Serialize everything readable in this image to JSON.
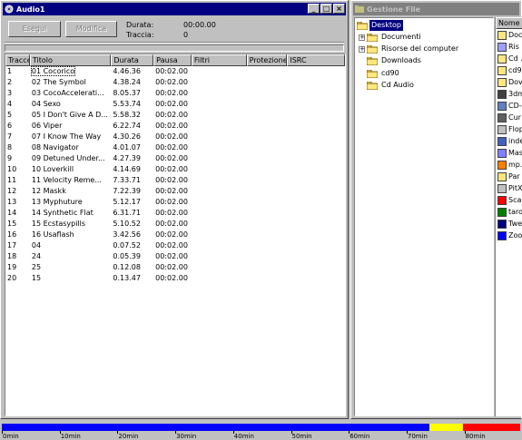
{
  "audio_window": {
    "title": "Audio1",
    "buttons": {
      "run": "Esegui",
      "edit": "Modifica"
    },
    "info": {
      "duration_label": "Durata:",
      "duration_value": "00:00.00",
      "tracks_label": "Traccia:",
      "tracks_value": "0"
    },
    "columns": [
      "Tracce",
      "Titolo",
      "Durata",
      "Pausa",
      "Filtri",
      "Protezione",
      "ISRC"
    ],
    "rows": [
      {
        "n": "1",
        "title": "01 Cocorico",
        "dur": "4.46.36",
        "pause": "00:02.00"
      },
      {
        "n": "2",
        "title": "02 The Symbol",
        "dur": "4.38.24",
        "pause": "00:02.00"
      },
      {
        "n": "3",
        "title": "03 CocoAccelerati...",
        "dur": "8.05.37",
        "pause": "00:02.00"
      },
      {
        "n": "4",
        "title": "04 Sexo",
        "dur": "5.53.74",
        "pause": "00:02.00"
      },
      {
        "n": "5",
        "title": "05 I Don't Give A D...",
        "dur": "5.58.32",
        "pause": "00:02.00"
      },
      {
        "n": "6",
        "title": "06 Viper",
        "dur": "6.22.74",
        "pause": "00:02.00"
      },
      {
        "n": "7",
        "title": "07 I Know The Way",
        "dur": "4.30.26",
        "pause": "00:02.00"
      },
      {
        "n": "8",
        "title": "08 Navigator",
        "dur": "4.01.07",
        "pause": "00:02.00"
      },
      {
        "n": "9",
        "title": "09 Detuned Under...",
        "dur": "4.27.39",
        "pause": "00:02.00"
      },
      {
        "n": "10",
        "title": "10 Loverkill",
        "dur": "4.14.69",
        "pause": "00:02.00"
      },
      {
        "n": "11",
        "title": "11 Velocity Reme...",
        "dur": "7.33.71",
        "pause": "00:02.00"
      },
      {
        "n": "12",
        "title": "12 Maskk",
        "dur": "7.22.39",
        "pause": "00:02.00"
      },
      {
        "n": "13",
        "title": "13 Myphuture",
        "dur": "5.12.17",
        "pause": "00:02.00"
      },
      {
        "n": "14",
        "title": "14 Synthetic Flat",
        "dur": "6.31.71",
        "pause": "00:02.00"
      },
      {
        "n": "15",
        "title": "15 Ecstasypills",
        "dur": "5.10.52",
        "pause": "00:02.00"
      },
      {
        "n": "16",
        "title": "16 Usaflash",
        "dur": "3.42.56",
        "pause": "00:02.00"
      },
      {
        "n": "17",
        "title": "04",
        "dur": "0.07.52",
        "pause": "00:02.00"
      },
      {
        "n": "18",
        "title": "24",
        "dur": "0.05.39",
        "pause": "00:02.00"
      },
      {
        "n": "19",
        "title": "25",
        "dur": "0.12.08",
        "pause": "00:02.00"
      },
      {
        "n": "20",
        "title": "15",
        "dur": "0.13.47",
        "pause": "00:02.00"
      }
    ]
  },
  "file_window": {
    "title": "Gestione File",
    "tree": [
      {
        "label": "Desktop",
        "level": 0,
        "expander": false,
        "selected": true
      },
      {
        "label": "Documenti",
        "level": 1,
        "expander": true,
        "selected": false
      },
      {
        "label": "Risorse del computer",
        "level": 1,
        "expander": true,
        "selected": false
      },
      {
        "label": "Downloads",
        "level": 1,
        "expander": false,
        "selected": false
      },
      {
        "label": "cd90",
        "level": 1,
        "expander": false,
        "selected": false
      },
      {
        "label": "Cd Audio",
        "level": 1,
        "expander": false,
        "selected": false
      }
    ],
    "list_header": "Nome",
    "list_items": [
      "Doc",
      "Ris",
      "Cd .",
      "cd9",
      "Dov",
      "3dm",
      "CD-",
      "Cur",
      "Flop",
      "inde",
      "Mas",
      "mp.",
      "Par",
      "PitX",
      "Sca",
      "taro",
      "Twe",
      "Zoo"
    ]
  },
  "timeline": {
    "labels": [
      "0min",
      "10min",
      "20min",
      "30min",
      "40min",
      "50min",
      "60min",
      "70min",
      "80min",
      "90min"
    ],
    "fill_blue_fraction": 0.825,
    "fill_yellow_end_fraction": 0.89,
    "colors": {
      "blue": "#0000ff",
      "yellow": "#ffff00",
      "red": "#ff0000"
    }
  }
}
